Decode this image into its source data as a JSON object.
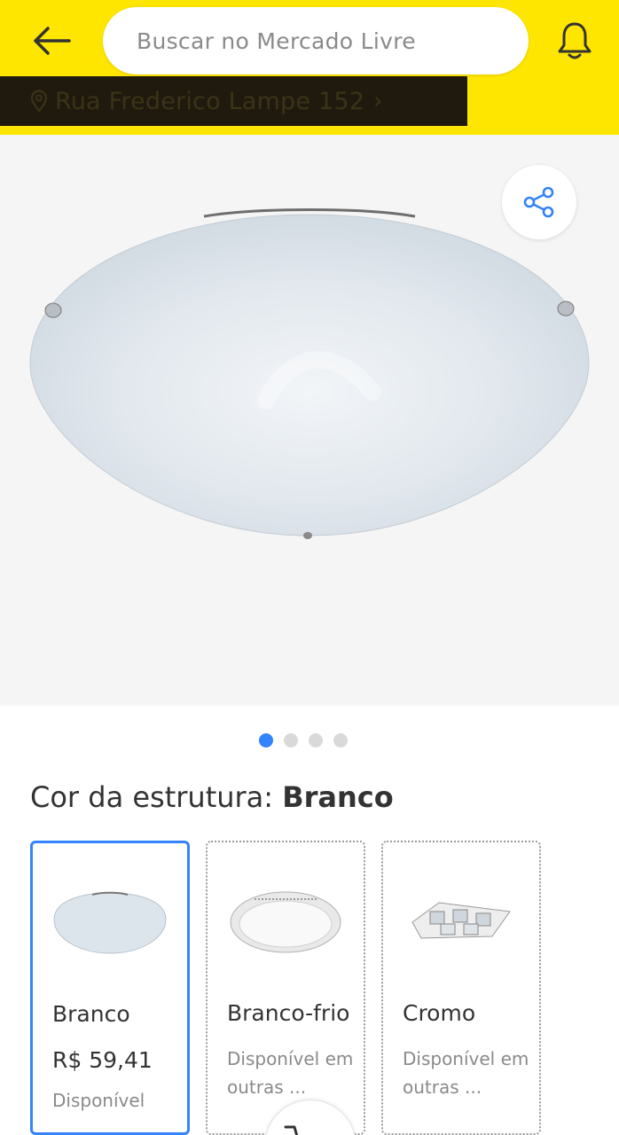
{
  "header": {
    "search_placeholder": "Buscar no Mercado Livre",
    "address": "Rua Frederico Lampe 152",
    "address_chevron": "›",
    "bg_color": "#ffe600"
  },
  "gallery": {
    "image_count": 4,
    "active_index": 0,
    "accent": "#3483fa"
  },
  "variation": {
    "label": "Cor da estrutura:",
    "selected_value": "Branco"
  },
  "variants": [
    {
      "name": "Branco",
      "price": "R$ 59,41",
      "status": "Disponível"
    },
    {
      "name": "Branco-frio",
      "status": "Disponível em outras ..."
    },
    {
      "name": "Cromo",
      "status": "Disponível em outras ..."
    }
  ],
  "icons": {
    "back": "arrow-left-icon",
    "bell": "bell-icon",
    "location": "location-pin-icon",
    "share": "share-icon",
    "cart": "cart-icon"
  }
}
